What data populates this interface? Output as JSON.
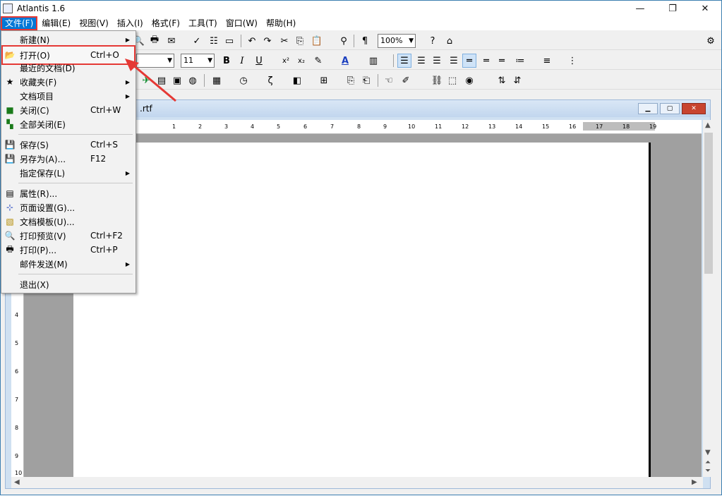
{
  "window": {
    "title": "Atlantis 1.6",
    "btn_min": "—",
    "btn_max": "❐",
    "btn_close": "✕"
  },
  "menubar": [
    {
      "label": "文件(F)"
    },
    {
      "label": "编辑(E)"
    },
    {
      "label": "视图(V)"
    },
    {
      "label": "插入(I)"
    },
    {
      "label": "格式(F)"
    },
    {
      "label": "工具(T)"
    },
    {
      "label": "窗口(W)"
    },
    {
      "label": "帮助(H)"
    }
  ],
  "toolbar": {
    "zoom": "100%",
    "font_size": "11",
    "bold": "B",
    "italic": "I",
    "underline": "U",
    "pilcrow": "¶",
    "superscript": "x²",
    "subscript": "x₂"
  },
  "document": {
    "title": ".rtf"
  },
  "ruler": {
    "ticks": [
      "1",
      "2",
      "3",
      "4",
      "5",
      "6",
      "7",
      "8",
      "9",
      "10",
      "11",
      "12",
      "13",
      "14",
      "15",
      "16",
      "17",
      "18",
      "19"
    ]
  },
  "vruler": {
    "ticks": [
      "4",
      "5",
      "6",
      "7",
      "8",
      "9",
      "10"
    ]
  },
  "file_menu": [
    {
      "label": "新建(N)",
      "shortcut": "",
      "submenu": true,
      "icon": "new-icon"
    },
    {
      "label": "打开(O)",
      "shortcut": "Ctrl+O",
      "submenu": false,
      "icon": "open-folder-icon"
    },
    {
      "label": "最近的文档(D)",
      "shortcut": "",
      "submenu": false,
      "icon": ""
    },
    {
      "label": "收藏夹(F)",
      "shortcut": "",
      "submenu": true,
      "icon": "favorites-icon"
    },
    {
      "label": "文档项目",
      "shortcut": "",
      "submenu": true,
      "icon": ""
    },
    {
      "label": "关闭(C)",
      "shortcut": "Ctrl+W",
      "submenu": false,
      "icon": "close-doc-icon"
    },
    {
      "label": "全部关闭(E)",
      "shortcut": "",
      "submenu": false,
      "icon": "close-all-icon"
    },
    {
      "label": "保存(S)",
      "shortcut": "Ctrl+S",
      "submenu": false,
      "icon": "save-icon"
    },
    {
      "label": "另存为(A)...",
      "shortcut": "F12",
      "submenu": false,
      "icon": "save-as-icon"
    },
    {
      "label": "指定保存(L)",
      "shortcut": "",
      "submenu": true,
      "icon": ""
    },
    {
      "label": "属性(R)...",
      "shortcut": "",
      "submenu": false,
      "icon": "properties-icon"
    },
    {
      "label": "页面设置(G)...",
      "shortcut": "",
      "submenu": false,
      "icon": "page-setup-icon"
    },
    {
      "label": "文档模板(U)...",
      "shortcut": "",
      "submenu": false,
      "icon": "template-icon"
    },
    {
      "label": "打印预览(V)",
      "shortcut": "Ctrl+F2",
      "submenu": false,
      "icon": "print-preview-icon"
    },
    {
      "label": "打印(P)...",
      "shortcut": "Ctrl+P",
      "submenu": false,
      "icon": "printer-icon"
    },
    {
      "label": "邮件发送(M)",
      "shortcut": "",
      "submenu": true,
      "icon": ""
    },
    {
      "label": "退出(X)",
      "shortcut": "",
      "submenu": false,
      "icon": ""
    }
  ]
}
